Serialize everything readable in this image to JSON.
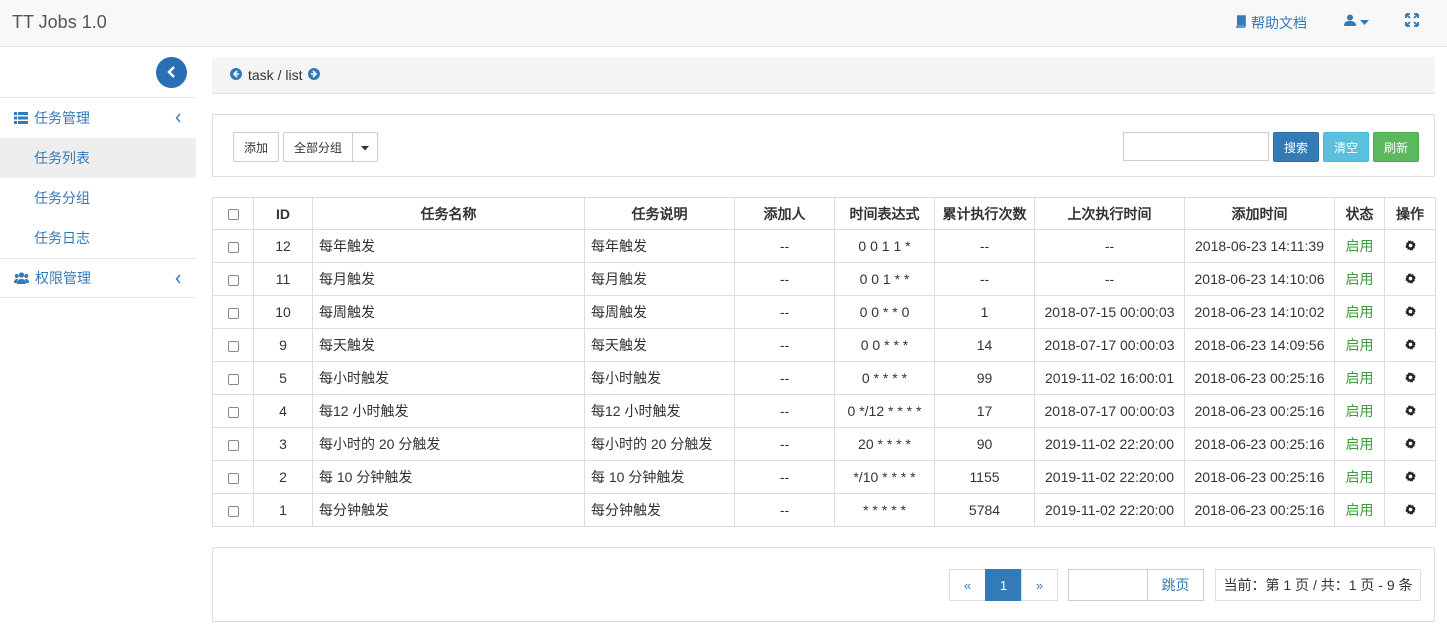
{
  "navbar": {
    "brand": "TT Jobs 1.0",
    "help_label": "帮助文档",
    "help_icon": "book-icon",
    "user_icon": "user-icon",
    "fullscreen_icon": "expand-icon"
  },
  "sidebar": {
    "groups": [
      {
        "label": "任务管理",
        "icon": "list-icon",
        "items": [
          "任务列表",
          "任务分组",
          "任务日志"
        ]
      },
      {
        "label": "权限管理",
        "icon": "users-icon",
        "items": []
      }
    ],
    "active_item": "任务列表"
  },
  "breadcrumb": {
    "text": "task / list"
  },
  "toolbar": {
    "add_label": "添加",
    "group_select": "全部分组",
    "search_placeholder": "",
    "search_label": "搜索",
    "clear_label": "清空",
    "refresh_label": "刷新"
  },
  "table": {
    "headers": [
      "ID",
      "任务名称",
      "任务说明",
      "添加人",
      "时间表达式",
      "累计执行次数",
      "上次执行时间",
      "添加时间",
      "状态",
      "操作"
    ],
    "rows": [
      {
        "id": "12",
        "name": "每年触发",
        "desc": "每年触发",
        "adder": "--",
        "cron": "0 0 1 1 *",
        "count": "--",
        "last_run": "--",
        "added": "2018-06-23 14:11:39",
        "status": "启用"
      },
      {
        "id": "11",
        "name": "每月触发",
        "desc": "每月触发",
        "adder": "--",
        "cron": "0 0 1 * *",
        "count": "--",
        "last_run": "--",
        "added": "2018-06-23 14:10:06",
        "status": "启用"
      },
      {
        "id": "10",
        "name": "每周触发",
        "desc": "每周触发",
        "adder": "--",
        "cron": "0 0 * * 0",
        "count": "1",
        "last_run": "2018-07-15 00:00:03",
        "added": "2018-06-23 14:10:02",
        "status": "启用"
      },
      {
        "id": "9",
        "name": "每天触发",
        "desc": "每天触发",
        "adder": "--",
        "cron": "0 0 * * *",
        "count": "14",
        "last_run": "2018-07-17 00:00:03",
        "added": "2018-06-23 14:09:56",
        "status": "启用"
      },
      {
        "id": "5",
        "name": "每小时触发",
        "desc": "每小时触发",
        "adder": "--",
        "cron": "0 * * * *",
        "count": "99",
        "last_run": "2019-11-02 16:00:01",
        "added": "2018-06-23 00:25:16",
        "status": "启用"
      },
      {
        "id": "4",
        "name": "每12 小时触发",
        "desc": "每12 小时触发",
        "adder": "--",
        "cron": "0 */12 * * * *",
        "count": "17",
        "last_run": "2018-07-17 00:00:03",
        "added": "2018-06-23 00:25:16",
        "status": "启用"
      },
      {
        "id": "3",
        "name": "每小时的 20 分触发",
        "desc": "每小时的 20 分触发",
        "adder": "--",
        "cron": "20 * * * *",
        "count": "90",
        "last_run": "2019-11-02 22:20:00",
        "added": "2018-06-23 00:25:16",
        "status": "启用"
      },
      {
        "id": "2",
        "name": "每 10 分钟触发",
        "desc": "每 10 分钟触发",
        "adder": "--",
        "cron": "*/10 * * * *",
        "count": "1155",
        "last_run": "2019-11-02 22:20:00",
        "added": "2018-06-23 00:25:16",
        "status": "启用"
      },
      {
        "id": "1",
        "name": "每分钟触发",
        "desc": "每分钟触发",
        "adder": "--",
        "cron": "* * * * *",
        "count": "5784",
        "last_run": "2019-11-02 22:20:00",
        "added": "2018-06-23 00:25:16",
        "status": "启用"
      }
    ]
  },
  "pagination": {
    "prev": "«",
    "current": "1",
    "next": "»",
    "jump_label": "跳页",
    "info": "当前：第 1 页 / 共：1 页 - 9 条"
  },
  "colors": {
    "primary": "#337ab7",
    "status_enabled": "#3c9b3c"
  }
}
